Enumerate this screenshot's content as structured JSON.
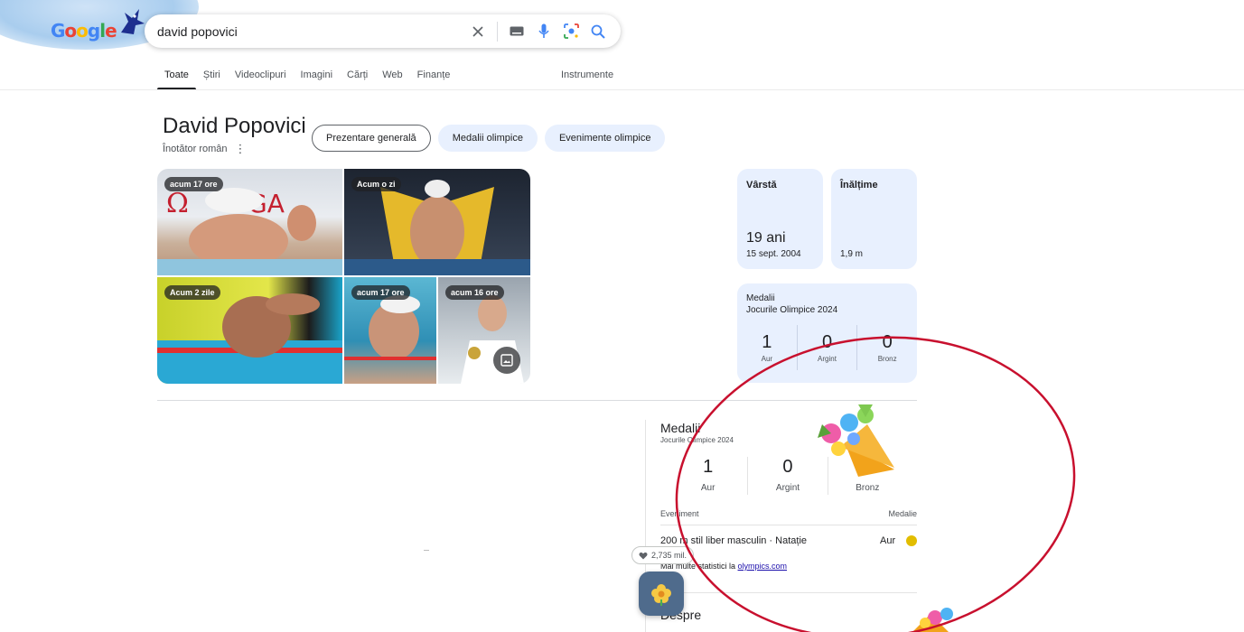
{
  "search": {
    "query": "david popovici"
  },
  "doodle": {
    "logo_text": "Google"
  },
  "tabs": [
    {
      "label": "Toate",
      "active": true
    },
    {
      "label": "Știri"
    },
    {
      "label": "Videoclipuri"
    },
    {
      "label": "Imagini"
    },
    {
      "label": "Cărți"
    },
    {
      "label": "Web"
    },
    {
      "label": "Finanțe"
    }
  ],
  "tools_label": "Instrumente",
  "entity": {
    "name": "David Popovici",
    "subtitle": "Înotător român"
  },
  "chips": [
    "Prezentare generală",
    "Medalii olimpice",
    "Evenimente olimpice"
  ],
  "images": [
    {
      "badge": "acum 17 ore"
    },
    {
      "badge": "Acum o zi"
    },
    {
      "badge": "Acum 2 zile"
    },
    {
      "badge": "acum 17 ore"
    },
    {
      "badge": "acum 16 ore"
    }
  ],
  "age_card": {
    "label": "Vârstă",
    "value": "19 ani",
    "detail": "15 sept. 2004"
  },
  "height_card": {
    "label": "Înălțime",
    "value": "1,9 m"
  },
  "medals_card": {
    "title": "Medalii",
    "subtitle": "Jocurile Olimpice 2024",
    "gold": "1",
    "gold_label": "Aur",
    "silver": "0",
    "silver_label": "Argint",
    "bronze": "0",
    "bronze_label": "Bronz"
  },
  "medals_panel": {
    "title": "Medalii",
    "subtitle": "Jocurile Olimpice 2024",
    "gold": "1",
    "gold_label": "Aur",
    "silver": "0",
    "silver_label": "Argint",
    "bronze": "0",
    "bronze_label": "Bronz",
    "col_event": "Eveniment",
    "col_medal": "Medalie",
    "event_name": "200 m stil liber masculin · Natație",
    "event_medal": "Aur",
    "more_prefix": "Mai multe statistici la ",
    "more_link": "olympics.com",
    "about": "Despre"
  },
  "likes": {
    "count": "2,735 mil."
  },
  "colors": {
    "annotation_circle": "#c8102e",
    "gold": "#e2bd00",
    "card_bg": "#e8f0fe"
  }
}
